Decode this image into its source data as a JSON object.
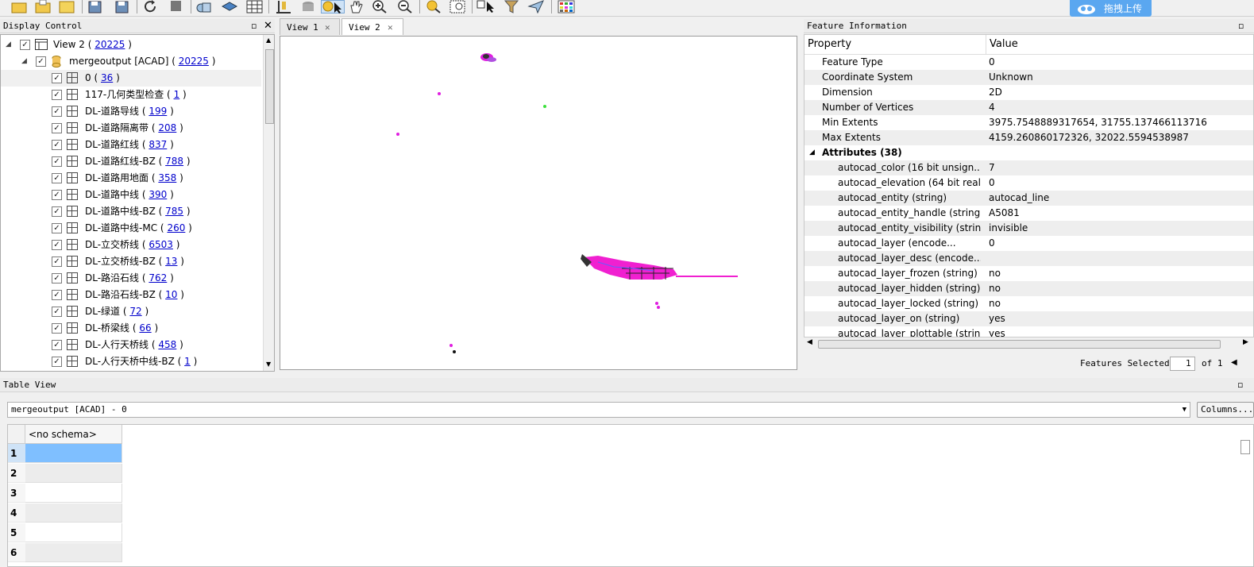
{
  "toolbar": {
    "upload_label": "拖拽上传"
  },
  "display_control": {
    "title": "Display Control",
    "view": {
      "label": "View 2 (",
      "count": "20225",
      "close": ")"
    },
    "dataset": {
      "label": "mergeoutput [ACAD] (",
      "count": "20225",
      "close": ")"
    },
    "layers": [
      {
        "name": "0 (",
        "count": "36"
      },
      {
        "name": "117-几何类型检查 (",
        "count": "1"
      },
      {
        "name": "DL-道路导线 (",
        "count": "199"
      },
      {
        "name": "DL-道路隔离带 (",
        "count": "208"
      },
      {
        "name": "DL-道路红线 (",
        "count": "837"
      },
      {
        "name": "DL-道路红线-BZ (",
        "count": "788"
      },
      {
        "name": "DL-道路用地面 (",
        "count": "358"
      },
      {
        "name": "DL-道路中线 (",
        "count": "390"
      },
      {
        "name": "DL-道路中线-BZ (",
        "count": "785"
      },
      {
        "name": "DL-道路中线-MC (",
        "count": "260"
      },
      {
        "name": "DL-立交桥线 (",
        "count": "6503"
      },
      {
        "name": "DL-立交桥线-BZ (",
        "count": "13"
      },
      {
        "name": "DL-路沿石线 (",
        "count": "762"
      },
      {
        "name": "DL-路沿石线-BZ (",
        "count": "10"
      },
      {
        "name": "DL-绿道 (",
        "count": "72"
      },
      {
        "name": "DL-桥梁线 (",
        "count": "66"
      },
      {
        "name": "DL-人行天桥线 (",
        "count": "458"
      },
      {
        "name": "DL-人行天桥中线-BZ (",
        "count": "1"
      }
    ]
  },
  "views": {
    "tabs": [
      {
        "label": "View 1"
      },
      {
        "label": "View 2"
      }
    ]
  },
  "feature_info": {
    "title": "Feature Information",
    "col_property": "Property",
    "col_value": "Value",
    "rows": [
      {
        "p": "Feature Type",
        "v": "0"
      },
      {
        "p": "Coordinate System",
        "v": "Unknown"
      },
      {
        "p": "Dimension",
        "v": "2D"
      },
      {
        "p": "Number of Vertices",
        "v": "4"
      },
      {
        "p": "Min Extents",
        "v": "3975.7548889317654, 31755.137466113716"
      },
      {
        "p": "Max Extents",
        "v": "4159.260860172326, 32022.5594538987"
      }
    ],
    "attributes_label": "Attributes (38)",
    "attributes": [
      {
        "p": "autocad_color (16 bit unsign...",
        "v": "7"
      },
      {
        "p": "autocad_elevation (64 bit real)",
        "v": "0"
      },
      {
        "p": "autocad_entity (string)",
        "v": "autocad_line"
      },
      {
        "p": "autocad_entity_handle (string)",
        "v": "A5081"
      },
      {
        "p": "autocad_entity_visibility (string)",
        "v": "invisible"
      },
      {
        "p": "autocad_layer (encode...",
        "v": "0"
      },
      {
        "p": "autocad_layer_desc (encode...",
        "v": ""
      },
      {
        "p": "autocad_layer_frozen (string)",
        "v": "no"
      },
      {
        "p": "autocad_layer_hidden (string)",
        "v": "no"
      },
      {
        "p": "autocad_layer_locked (string)",
        "v": "no"
      },
      {
        "p": "autocad_layer_on (string)",
        "v": "yes"
      },
      {
        "p": "autocad_layer_plottable (string)",
        "v": "yes"
      }
    ],
    "selected_label": "Features Selected:",
    "selected_value": "1",
    "selected_of": "of 1"
  },
  "table_view": {
    "title": "Table View",
    "source": "mergeoutput [ACAD] - 0",
    "columns_button": "Columns...",
    "header": "<no schema>",
    "rows": [
      "1",
      "2",
      "3",
      "4",
      "5",
      "6"
    ]
  }
}
